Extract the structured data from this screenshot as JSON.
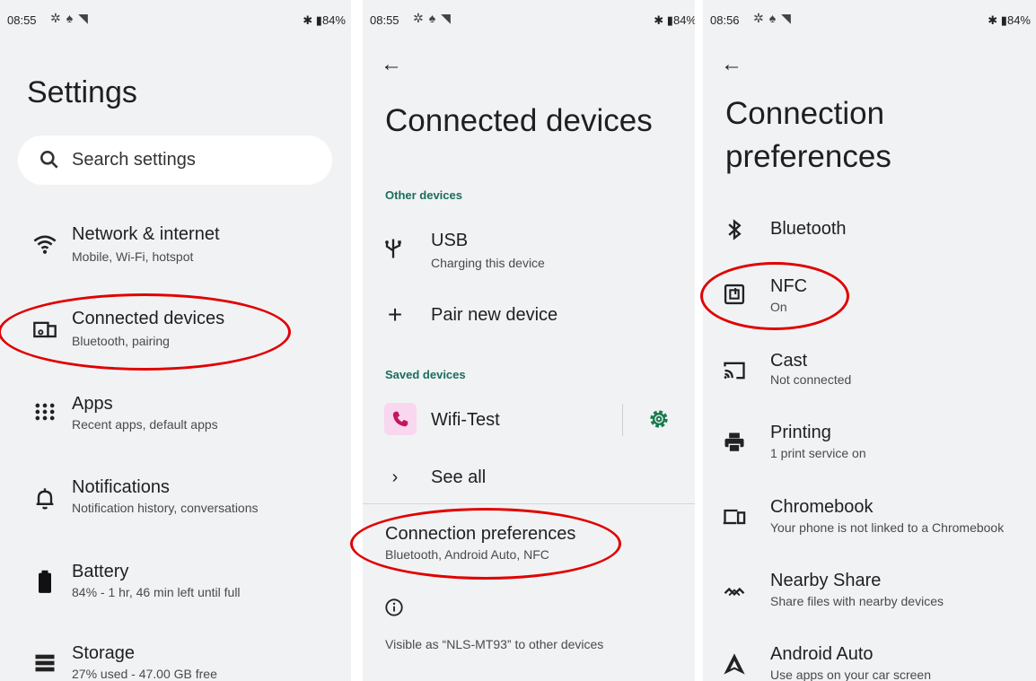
{
  "panel1": {
    "status": {
      "time": "08:55",
      "battery": "84%"
    },
    "title": "Settings",
    "search": {
      "placeholder": "Search settings"
    },
    "items": [
      {
        "title": "Network & internet",
        "subtitle": "Mobile, Wi-Fi, hotspot",
        "icon": "wifi-icon"
      },
      {
        "title": "Connected devices",
        "subtitle": "Bluetooth, pairing",
        "icon": "devices-icon"
      },
      {
        "title": "Apps",
        "subtitle": "Recent apps, default apps",
        "icon": "apps-icon"
      },
      {
        "title": "Notifications",
        "subtitle": "Notification history, conversations",
        "icon": "bell-icon"
      },
      {
        "title": "Battery",
        "subtitle": "84% - 1 hr, 46 min left until full",
        "icon": "battery-icon"
      },
      {
        "title": "Storage",
        "subtitle": "27% used - 47.00 GB free",
        "icon": "storage-icon"
      }
    ]
  },
  "panel2": {
    "status": {
      "time": "08:55",
      "battery": "84%"
    },
    "title": "Connected devices",
    "other_devices_header": "Other devices",
    "usb": {
      "title": "USB",
      "subtitle": "Charging this device",
      "icon": "usb-icon"
    },
    "pair": {
      "title": "Pair new device",
      "icon": "plus-icon"
    },
    "saved_devices_header": "Saved devices",
    "saved": {
      "title": "Wifi-Test",
      "icon": "phone-icon",
      "settings_icon": "gear-icon"
    },
    "see_all": {
      "title": "See all",
      "icon": "chevron-right-icon"
    },
    "conn_prefs": {
      "title": "Connection preferences",
      "subtitle": "Bluetooth, Android Auto, NFC"
    },
    "info_icon": "info-icon",
    "footer": "Visible as “NLS-MT93” to other devices"
  },
  "panel3": {
    "status": {
      "time": "08:56",
      "battery": "84%"
    },
    "title_line1": "Connection",
    "title_line2": "preferences",
    "items": [
      {
        "title": "Bluetooth",
        "subtitle": "",
        "icon": "bluetooth-icon"
      },
      {
        "title": "NFC",
        "subtitle": "On",
        "icon": "nfc-icon"
      },
      {
        "title": "Cast",
        "subtitle": "Not connected",
        "icon": "cast-icon"
      },
      {
        "title": "Printing",
        "subtitle": "1 print service on",
        "icon": "printer-icon"
      },
      {
        "title": "Chromebook",
        "subtitle": "Your phone is not linked to a Chromebook",
        "icon": "chromebook-icon"
      },
      {
        "title": "Nearby Share",
        "subtitle": "Share files with nearby devices",
        "icon": "nearby-share-icon"
      },
      {
        "title": "Android Auto",
        "subtitle": "Use apps on your car screen",
        "icon": "android-auto-icon"
      }
    ]
  },
  "colors": {
    "highlight": "#e00000",
    "section_header": "#1a6d5c",
    "gear": "#1a7a4e",
    "phone_tile": "#f8d7ef",
    "phone": "#c2185b"
  }
}
